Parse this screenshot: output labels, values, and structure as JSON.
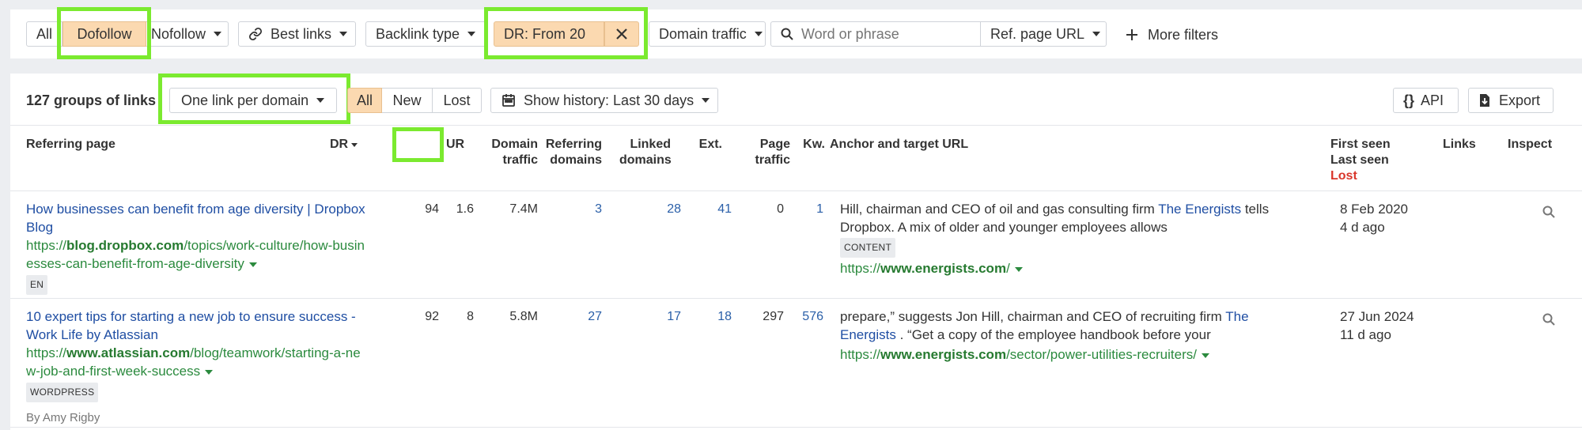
{
  "filters": {
    "all": "All",
    "dofollow": "Dofollow",
    "nofollow": "Nofollow",
    "best_links": "Best links",
    "backlink_type": "Backlink type",
    "dr": "DR: From 20",
    "domain_traffic": "Domain traffic",
    "search_placeholder": "Word or phrase",
    "ref_page_url": "Ref. page URL",
    "more_filters": "More filters"
  },
  "toolbar": {
    "groups": "127 groups of links",
    "per_domain": "One link per domain",
    "seg_all": "All",
    "seg_new": "New",
    "seg_lost": "Lost",
    "history": "Show history: Last 30 days",
    "api": "API",
    "export": "Export"
  },
  "columns": {
    "referring_page": "Referring page",
    "dr": "DR",
    "ur": "UR",
    "domain_traffic_1": "Domain",
    "domain_traffic_2": "traffic",
    "referring_domains_1": "Referring",
    "referring_domains_2": "domains",
    "linked_domains_1": "Linked",
    "linked_domains_2": "domains",
    "ext": "Ext.",
    "page_traffic_1": "Page",
    "page_traffic_2": "traffic",
    "kw": "Kw.",
    "anchor": "Anchor and target URL",
    "first_seen": "First seen",
    "last_seen": "Last seen",
    "lost": "Lost",
    "links": "Links",
    "inspect": "Inspect"
  },
  "rows": [
    {
      "title_1": "How businesses can benefit from age diversity | Dropbox",
      "title_2": "Blog",
      "url_prefix": "https://",
      "url_domain": "blog.dropbox.com",
      "url_rest_1": "/topics/work-culture/how-busin",
      "url_rest_2": "esses-can-benefit-from-age-diversity",
      "tag": "EN",
      "author": "",
      "dr": "94",
      "ur": "1.6",
      "domain_traffic": "7.4M",
      "referring_domains": "3",
      "linked_domains": "28",
      "ext": "41",
      "page_traffic": "0",
      "kw": "1",
      "anchor_1a": "Hill, chairman and CEO of oil and gas consulting firm ",
      "anchor_1_link": "The Energists",
      "anchor_1b": " tells",
      "anchor_2": "Dropbox. A mix of older and younger employees allows",
      "anchor_tag": "CONTENT",
      "target_prefix": "https://",
      "target_domain": "www.energists.com",
      "target_rest": "/",
      "first_seen": "8 Feb 2020",
      "last_seen": "4 d ago"
    },
    {
      "title_1": "10 expert tips for starting a new job to ensure success -",
      "title_2": "Work Life by Atlassian",
      "url_prefix": "https://",
      "url_domain": "www.atlassian.com",
      "url_rest_1": "/blog/teamwork/starting-a-ne",
      "url_rest_2": "w-job-and-first-week-success",
      "tag": "WORDPRESS",
      "author": "By Amy Rigby",
      "dr": "92",
      "ur": "8",
      "domain_traffic": "5.8M",
      "referring_domains": "27",
      "linked_domains": "17",
      "ext": "18",
      "page_traffic": "297",
      "kw": "576",
      "anchor_1a": "prepare,” suggests Jon Hill, chairman and CEO of recruiting firm ",
      "anchor_1_link": "The",
      "anchor_1b": "",
      "anchor_2_link": "Energists",
      "anchor_2": " . “Get a copy of the employee handbook before your",
      "target_prefix": "https://",
      "target_domain": "www.energists.com",
      "target_rest": "/sector/power-utilities-recruiters/",
      "first_seen": "27 Jun 2024",
      "last_seen": "11 d ago"
    }
  ],
  "colors": {
    "highlight": "#7bea2f",
    "active_chip": "#fbd9b0",
    "link": "#1f4ea3",
    "url": "#2b8a3e",
    "lost": "#d9362b"
  }
}
